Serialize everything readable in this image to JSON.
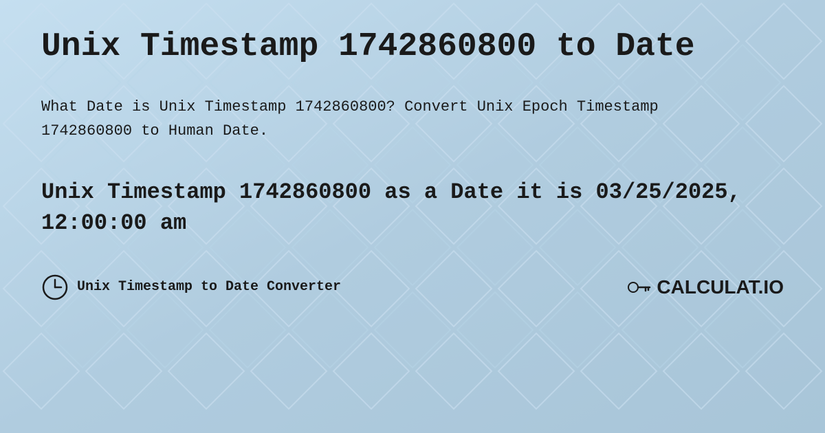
{
  "page": {
    "title": "Unix Timestamp 1742860800 to Date",
    "background_color": "#b8d4e8",
    "description": "What Date is Unix Timestamp 1742860800? Convert Unix Epoch Timestamp 1742860800 to Human Date.",
    "result": "Unix Timestamp 1742860800 as a Date it is 03/25/2025, 12:00:00 am",
    "footer": {
      "label": "Unix Timestamp to Date Converter"
    },
    "logo": {
      "text": "CALCULAT.IO"
    }
  }
}
